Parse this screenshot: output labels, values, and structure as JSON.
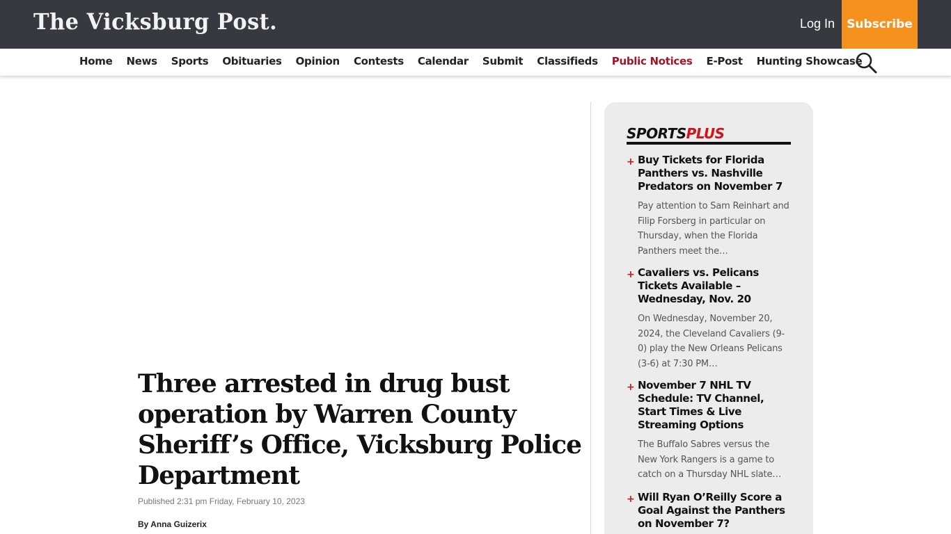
{
  "header": {
    "logo": "The Vicksburg Post.",
    "login_label": "Log In",
    "subscribe_label": "Subscribe",
    "subscribe_color": "#f5921e",
    "bar_color": "#363940"
  },
  "nav": {
    "items": [
      "Home",
      "News",
      "Sports",
      "Obituaries",
      "Opinion",
      "Contests",
      "Calendar",
      "Submit",
      "Classifieds",
      "Public Notices",
      "E-Post",
      "Hunting Showcase"
    ],
    "highlight_color": "#a1152a",
    "search_icon": "search-icon"
  },
  "article": {
    "headline": "Three arrested in drug bust operation by Warren County Sheriff’s Office, Vicksburg Police Department",
    "published": "Published 2:31 pm Friday, February 10, 2023",
    "byline_prefix": "By",
    "author": "Anna Guizerix"
  },
  "sidebar": {
    "title_a": "SPORTS",
    "title_b": "PLUS",
    "items": [
      {
        "headline": "Buy Tickets for Florida Panthers vs. Nashville Predators on November 7",
        "summary": "Pay attention to Sam Reinhart and Filip Forsberg in particular on Thursday, when the Florida Panthers meet the…"
      },
      {
        "headline": "Cavaliers vs. Pelicans Tickets Available – Wednesday, Nov. 20",
        "summary": "On Wednesday, November 20, 2024, the Cleveland Cavaliers (9-0) play the New Orleans Pelicans (3-6) at 7:30 PM…"
      },
      {
        "headline": "November 7 NHL TV Schedule: TV Channel, Start Times & Live Streaming Options",
        "summary": "The Buffalo Sabres versus the New York Rangers is a game to catch on a Thursday NHL slate…"
      },
      {
        "headline": "Will Ryan O’Reilly Score a Goal Against the Panthers on November 7?",
        "summary": ""
      }
    ]
  }
}
